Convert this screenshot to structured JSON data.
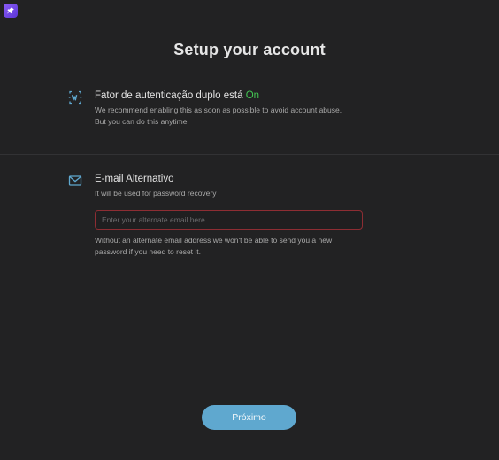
{
  "app": {
    "badge_icon": "pin-icon",
    "badge_color": "#7a4de8"
  },
  "page": {
    "title": "Setup your account"
  },
  "two_factor": {
    "icon": "two-factor-shield-icon",
    "heading": "Fator de autenticação duplo está",
    "status": "On",
    "status_color": "#43c653",
    "description_line1": "We recommend enabling this as soon as possible to avoid account abuse.",
    "description_line2": "But you can do this anytime."
  },
  "alternate_email": {
    "icon": "mail-icon",
    "heading": "E-mail Alternativo",
    "subtitle": "It will be used for password recovery",
    "input_value": "",
    "input_placeholder": "Enter your alternate email here...",
    "input_border_color": "#8d2d33",
    "helper_line1": "Without an alternate email address we won't be able to send you a new",
    "helper_line2": "password if you need to reset it."
  },
  "actions": {
    "next_label": "Próximo",
    "next_color": "#5fa8cf"
  }
}
